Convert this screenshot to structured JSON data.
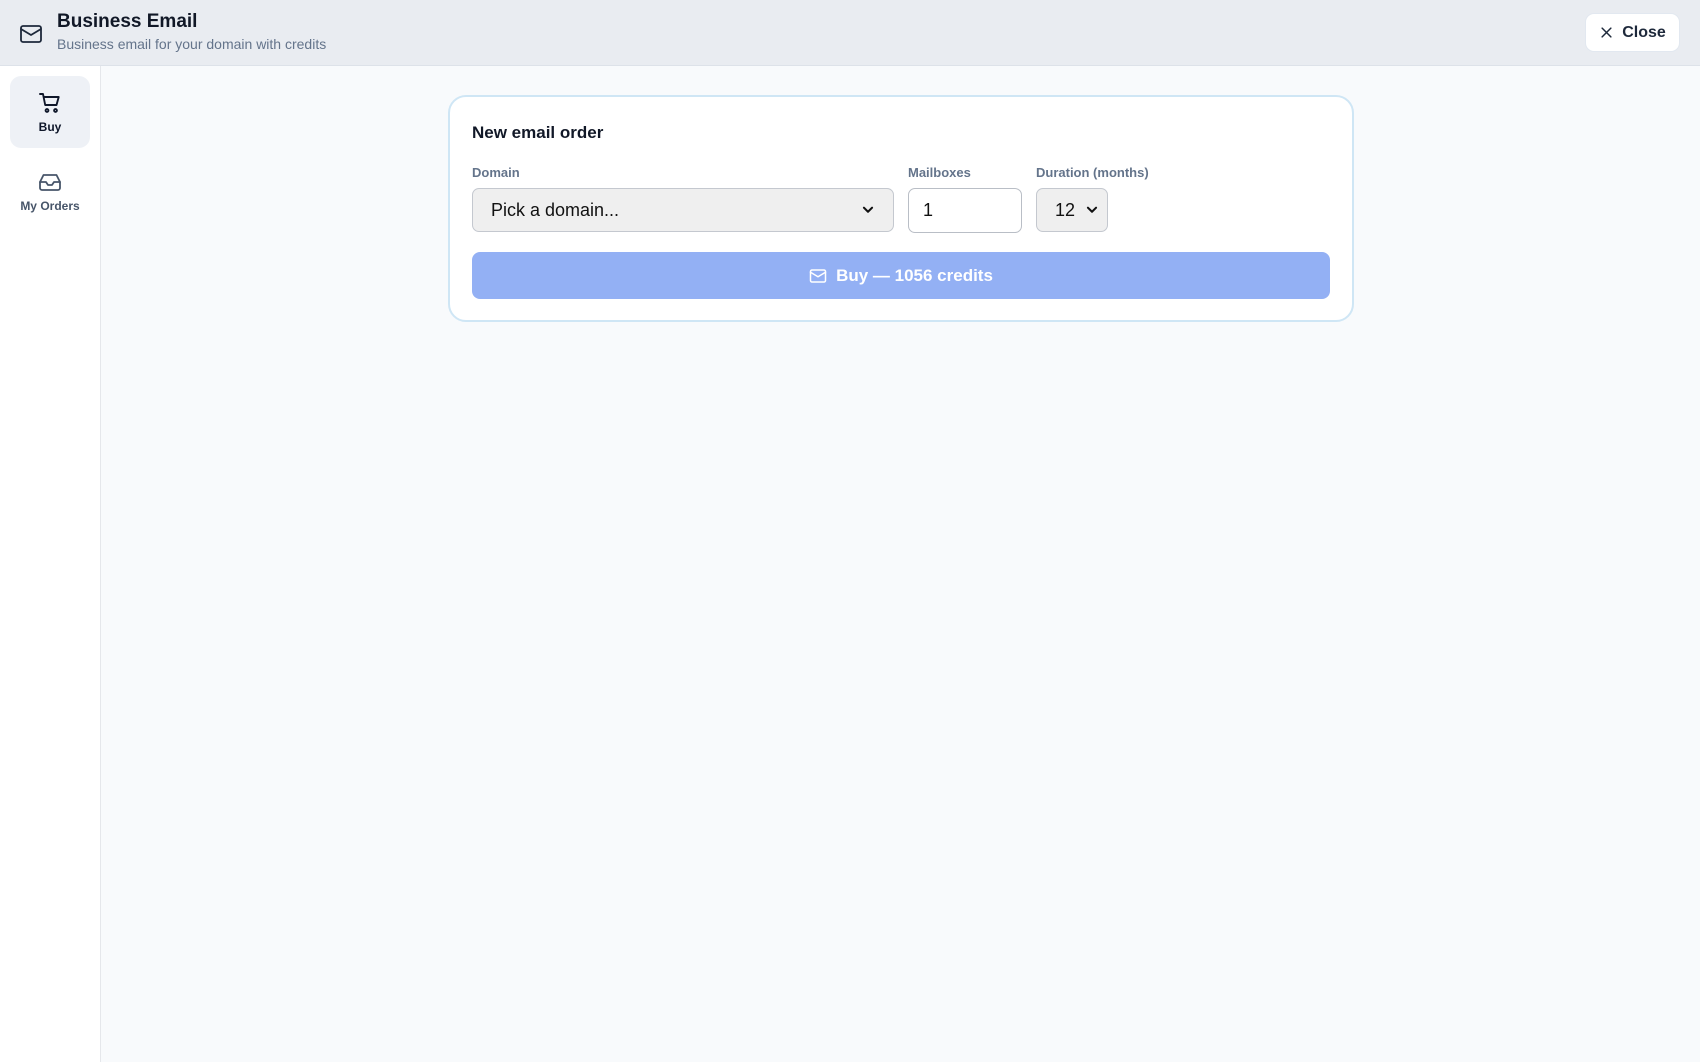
{
  "header": {
    "icon": "mail-icon",
    "title": "Business Email",
    "subtitle": "Business email for your domain with credits",
    "close_label": "Close"
  },
  "sidebar": {
    "items": [
      {
        "label": "Buy",
        "icon": "cart-icon",
        "active": true
      },
      {
        "label": "My Orders",
        "icon": "inbox-icon",
        "active": false
      }
    ]
  },
  "order_card": {
    "title": "New email order",
    "domain": {
      "label": "Domain",
      "selected": "Pick a domain..."
    },
    "mailboxes": {
      "label": "Mailboxes",
      "value": "1"
    },
    "duration": {
      "label": "Duration (months)",
      "selected": "12"
    },
    "buy_button_label": "Buy — 1056 credits"
  },
  "colors": {
    "header_bg": "#e9ecf1",
    "card_border": "#cfe6f5",
    "buy_button_bg": "#93b0f4"
  }
}
